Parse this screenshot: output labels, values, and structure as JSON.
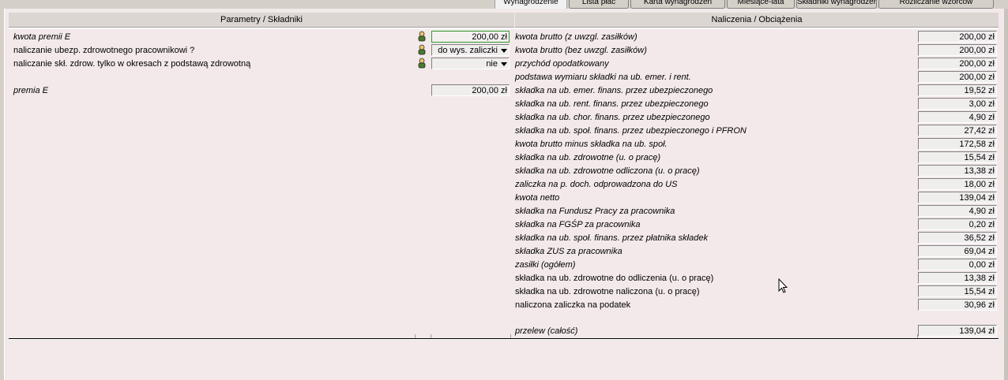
{
  "tabs": [
    {
      "label": "Wynagrodzenie",
      "active": true
    },
    {
      "label": "Lista płac",
      "active": false
    },
    {
      "label": "Karta wynagrodzeń",
      "active": false
    },
    {
      "label": "Miesiące-lata",
      "active": false
    },
    {
      "label": "Składniki wynagrodzeń",
      "active": false
    },
    {
      "label": "Rozliczanie wzorców",
      "active": false
    }
  ],
  "headers": {
    "left": "Parametry / Składniki",
    "right": "Naliczenia / Obciążenia"
  },
  "left_rows": [
    {
      "label": "kwota premii E",
      "value": "200,00 zł"
    },
    {
      "label": "naliczanie ubezp. zdrowotnego pracownikowi ?",
      "value": "do wys. zaliczki"
    },
    {
      "label": "naliczanie skł. zdrow. tylko w okresach z podstawą zdrowotną",
      "value": "nie"
    },
    {
      "label": "premia E",
      "value": "200,00 zł"
    }
  ],
  "right_rows": [
    {
      "label": "kwota brutto (z uwzgl. zasiłków)",
      "value": "200,00 zł"
    },
    {
      "label": "kwota brutto (bez uwzgl. zasiłków)",
      "value": "200,00 zł"
    },
    {
      "label": "przychód opodatkowany",
      "value": "200,00 zł"
    },
    {
      "label": "podstawa wymiaru składki na ub. emer. i rent.",
      "value": "200,00 zł"
    },
    {
      "label": "składka na ub. emer. finans. przez ubezpieczonego",
      "value": "19,52 zł"
    },
    {
      "label": "składka na ub. rent. finans. przez ubezpieczonego",
      "value": "3,00 zł"
    },
    {
      "label": "składka na ub. chor. finans. przez ubezpieczonego",
      "value": "4,90 zł"
    },
    {
      "label": "składka na ub. społ. finans. przez ubezpieczonego i PFRON",
      "value": "27,42 zł"
    },
    {
      "label": "kwota brutto minus składka na ub. społ.",
      "value": "172,58 zł"
    },
    {
      "label": "składka na ub. zdrowotne (u. o pracę)",
      "value": "15,54 zł"
    },
    {
      "label": "składka na ub. zdrowotne odliczona (u. o pracę)",
      "value": "13,38 zł"
    },
    {
      "label": "zaliczka na p. doch. odprowadzona do US",
      "value": "18,00 zł"
    },
    {
      "label": "kwota netto",
      "value": "139,04 zł"
    },
    {
      "label": "składka na Fundusz Pracy za pracownika",
      "value": "4,90 zł"
    },
    {
      "label": "składka na FGŚP za pracownika",
      "value": "0,20 zł"
    },
    {
      "label": "składka na ub. społ. finans. przez płatnika składek",
      "value": "36,52 zł"
    },
    {
      "label": "składka ZUS za pracownika",
      "value": "69,04 zł"
    },
    {
      "label": "zasiłki (ogółem)",
      "value": "0,00 zł"
    },
    {
      "label": "składka na ub. zdrowotne do odliczenia (u. o pracę)",
      "value": "13,38 zł"
    },
    {
      "label": "składka na ub. zdrowotne naliczona (u. o pracę)",
      "value": "15,54 zł"
    },
    {
      "label": "naliczona zaliczka na podatek",
      "value": "30,96 zł"
    },
    {
      "label": "przelew (całość)",
      "value": "139,04 zł"
    }
  ]
}
